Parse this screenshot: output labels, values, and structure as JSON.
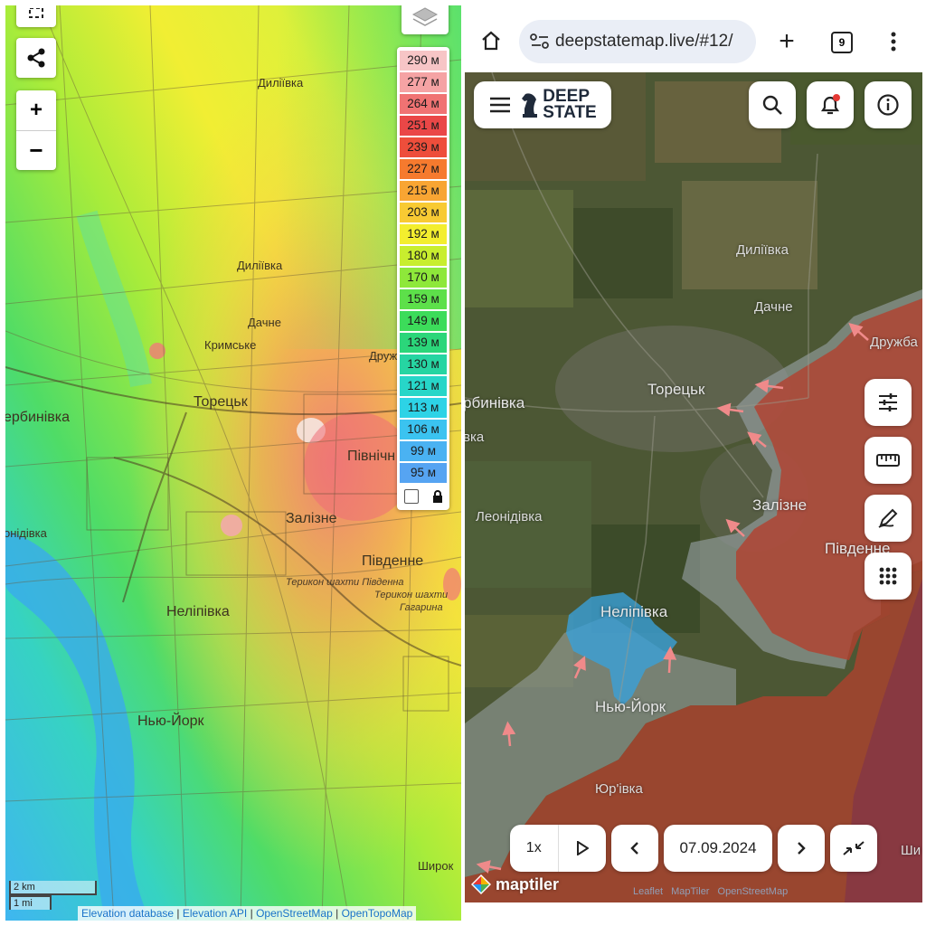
{
  "elevation_map": {
    "legend": {
      "items": [
        {
          "label": "290 м",
          "color": "#f7c5c6"
        },
        {
          "label": "277 м",
          "color": "#f5a3a4"
        },
        {
          "label": "264 м",
          "color": "#f07373"
        },
        {
          "label": "251 м",
          "color": "#ea4747"
        },
        {
          "label": "239 м",
          "color": "#ee4e3b"
        },
        {
          "label": "227 м",
          "color": "#f67a2e"
        },
        {
          "label": "215 м",
          "color": "#f8a533"
        },
        {
          "label": "203 м",
          "color": "#f8ca33"
        },
        {
          "label": "192 м",
          "color": "#f3ee2e"
        },
        {
          "label": "180 м",
          "color": "#c8ee2e"
        },
        {
          "label": "170 м",
          "color": "#8ee83a"
        },
        {
          "label": "159 м",
          "color": "#5de04a"
        },
        {
          "label": "149 м",
          "color": "#3cdc5a"
        },
        {
          "label": "139 м",
          "color": "#2bd67a"
        },
        {
          "label": "130 м",
          "color": "#26d5a2"
        },
        {
          "label": "121 м",
          "color": "#27d6c8"
        },
        {
          "label": "113 м",
          "color": "#2dd3e6"
        },
        {
          "label": "106 м",
          "color": "#3bc3f0"
        },
        {
          "label": "99 м",
          "color": "#4ab2f2"
        },
        {
          "label": "95 м",
          "color": "#56a4f2"
        }
      ]
    },
    "place_labels": {
      "dyliivka_1": "Диліївка",
      "dyliivka_2": "Диліївка",
      "dachne": "Дачне",
      "krymske": "Кримське",
      "druzhba": "Друж",
      "toretsk": "Торецьк",
      "shcherbynivka": "ербинівка",
      "pivnichne": "Північн",
      "zalizne": "Залізне",
      "pivdenne": "Південне",
      "terykon_1": "Терикон шахти Південна",
      "terykon_2": "Терикон шахти",
      "gagarina": "Гагарина",
      "leonidivka": "онідівка",
      "nelipivka": "Неліпівка",
      "new_york": "Нью-Йорк",
      "shyrok": "Широк"
    },
    "scale": {
      "km": "2 km",
      "mi": "1 mi"
    },
    "attribution": [
      "Elevation database",
      "Elevation API",
      "OpenStreetMap",
      "OpenTopoMap"
    ]
  },
  "browser": {
    "url": "deepstatemap.live/#12/",
    "tab_count": "9"
  },
  "deepstate": {
    "logo_line1": "DEEP",
    "logo_line2": "STATE",
    "place_labels": {
      "dyliivka": "Диліївка",
      "dachne": "Дачне",
      "druzhba": "Дружба",
      "toretsk": "Торецьк",
      "shcherbynivka": "рбинівка",
      "pivnichne": "вка",
      "zalizne": "Залізне",
      "pivdenne": "Південне",
      "leonidivka": "Леонідівка",
      "nelipivka": "Неліпівка",
      "new_york": "Нью-Йорк",
      "yurivka": "Юр'івка",
      "shy": "Ши"
    },
    "playback": {
      "speed": "1x",
      "date": "07.09.2024"
    },
    "maptiler": "maptiler",
    "attribution": [
      "Leaflet",
      "MapTiler",
      "OpenStreetMap"
    ],
    "colors": {
      "occupied": "#b3402e",
      "contested": "#9aa4a8",
      "liberated": "#3aa0d8",
      "arrow": "#f08a8a",
      "notify_dot": "#e53935"
    }
  }
}
